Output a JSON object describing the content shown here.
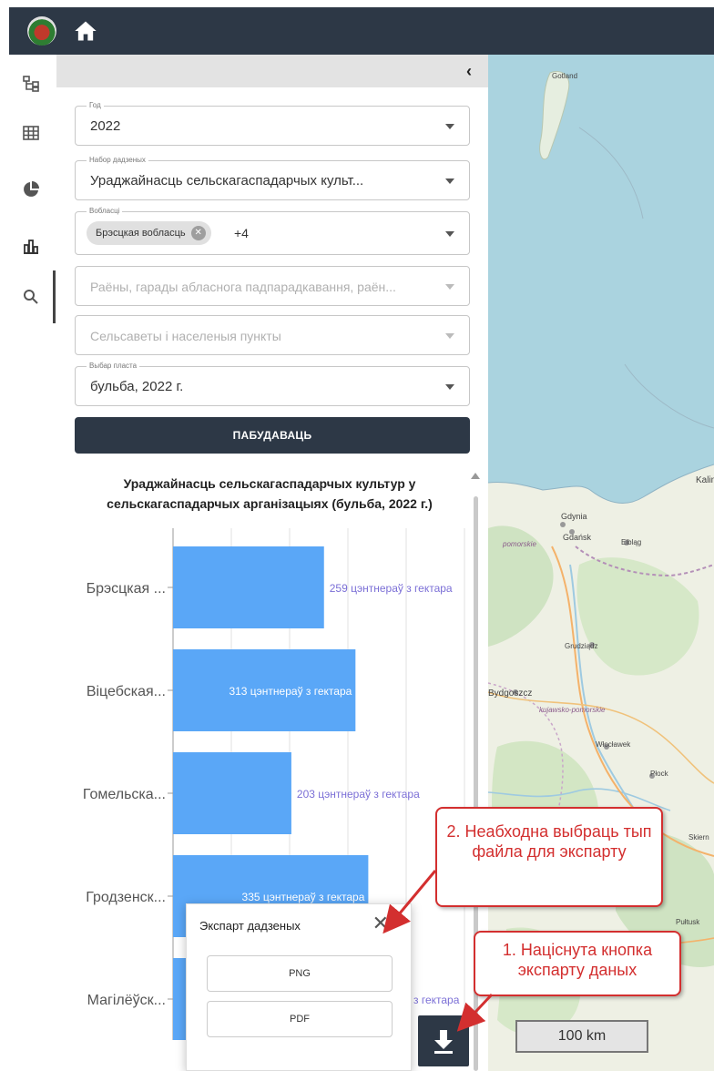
{
  "topbar": {
    "logo": "app-logo",
    "home_icon": "home-icon"
  },
  "rail": [
    {
      "icon": "layers-tree-icon"
    },
    {
      "icon": "table-icon"
    },
    {
      "icon": "pie-chart-icon"
    },
    {
      "icon": "bar-chart-icon",
      "active": true
    },
    {
      "icon": "search-icon"
    }
  ],
  "panel": {
    "collapse_glyph": "‹",
    "year": {
      "label": "Год",
      "value": "2022"
    },
    "dataset": {
      "label": "Набор дадзеных",
      "value": "Ураджайнасць сельскагаспадарчых культ..."
    },
    "regions": {
      "label": "Вобласці",
      "chip": "Брэсцкая вобласць",
      "more": "+4"
    },
    "districts": {
      "placeholder": "Раёны, гарады абласнога падпарадкавання, раён..."
    },
    "settlements": {
      "placeholder": "Сельсаветы і населеныя пункты"
    },
    "layer": {
      "label": "Выбар пласта",
      "value": "бульба, 2022 г."
    },
    "build_label": "ПАБУДАВАЦЬ"
  },
  "chart_data": {
    "type": "bar",
    "orientation": "horizontal",
    "title": "Ураджайнасць сельскагаспадарчых культур у сельскагаспадарчых арганізацыях (бульба, 2022 г.)",
    "categories": [
      "Брэсцкая ...",
      "Віцебская...",
      "Гомельска...",
      "Гродзенск...",
      "Магілёўск..."
    ],
    "values": [
      259,
      313,
      203,
      335,
      null
    ],
    "data_labels": [
      "259 цэнтнераў з гектара",
      "313 цэнтнераў з гектара",
      "203 цэнтнераў з гектара",
      "335 цэнтнераў з гектара",
      "з гектара"
    ],
    "bar_color": "#5aa7f7",
    "label_color_outside": "#7b6fd6",
    "label_color_inside": "#ffffff",
    "xlim": [
      0,
      500
    ],
    "grid": true
  },
  "export_popup": {
    "title": "Экспарт дадзеных",
    "close_icon": "close-icon",
    "png_label": "PNG",
    "pdf_label": "PDF"
  },
  "download_button": {
    "icon": "download-icon"
  },
  "map": {
    "labels": [
      "Gotland",
      "Gdynia",
      "Gdańsk",
      "Elbląg",
      "Grudziądz",
      "Bydgoszcz",
      "Włocławek",
      "Płock",
      "Kalin",
      "pomorskie",
      "kujawsko-pomorskie",
      "Skiern",
      "Pułtusk"
    ],
    "scale": "100 km"
  },
  "callouts": {
    "step2": "2. Неабходна выбраць тып файла для экспарту",
    "step1": "1. Націснута кнопка экспарту даных"
  }
}
